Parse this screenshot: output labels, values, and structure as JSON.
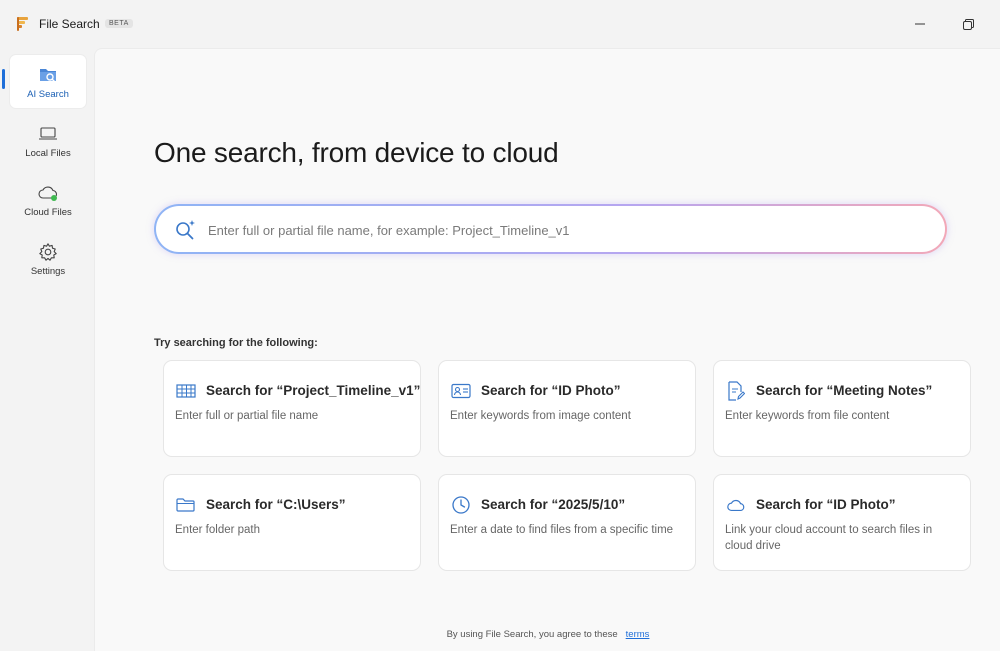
{
  "window": {
    "title": "File Search",
    "badge": "BETA"
  },
  "sidebar": {
    "items": [
      {
        "label": "AI Search",
        "icon": "ai-search-icon",
        "active": true
      },
      {
        "label": "Local Files",
        "icon": "laptop-icon"
      },
      {
        "label": "Cloud Files",
        "icon": "cloud-icon"
      },
      {
        "label": "Settings",
        "icon": "gear-icon"
      }
    ]
  },
  "main": {
    "headline": "One search, from device to cloud",
    "search": {
      "placeholder": "Enter full or partial file name, for example: Project_Timeline_v1",
      "value": ""
    },
    "suggestions_label": "Try searching for the following:",
    "cards": [
      {
        "title": "Search for “Project_Timeline_v1”",
        "desc": "Enter full or partial file name",
        "icon": "table-icon"
      },
      {
        "title": "Search for “ID Photo”",
        "desc": "Enter keywords from image content",
        "icon": "id-card-icon"
      },
      {
        "title": "Search for “Meeting Notes”",
        "desc": "Enter keywords from file content",
        "icon": "document-edit-icon"
      },
      {
        "title": "Search for “C:\\Users”",
        "desc": "Enter folder path",
        "icon": "folder-icon"
      },
      {
        "title": "Search for “2025/5/10”",
        "desc": "Enter a date to find files from a specific time",
        "icon": "clock-icon"
      },
      {
        "title": "Search for “ID Photo”",
        "desc": "Link your cloud account to search files in cloud drive",
        "icon": "cloud-icon"
      }
    ],
    "footer": {
      "text": "By using File Search, you agree to these",
      "link": "terms"
    }
  },
  "colors": {
    "accent": "#1f6fd9",
    "icon_blue": "#3a78c9"
  }
}
